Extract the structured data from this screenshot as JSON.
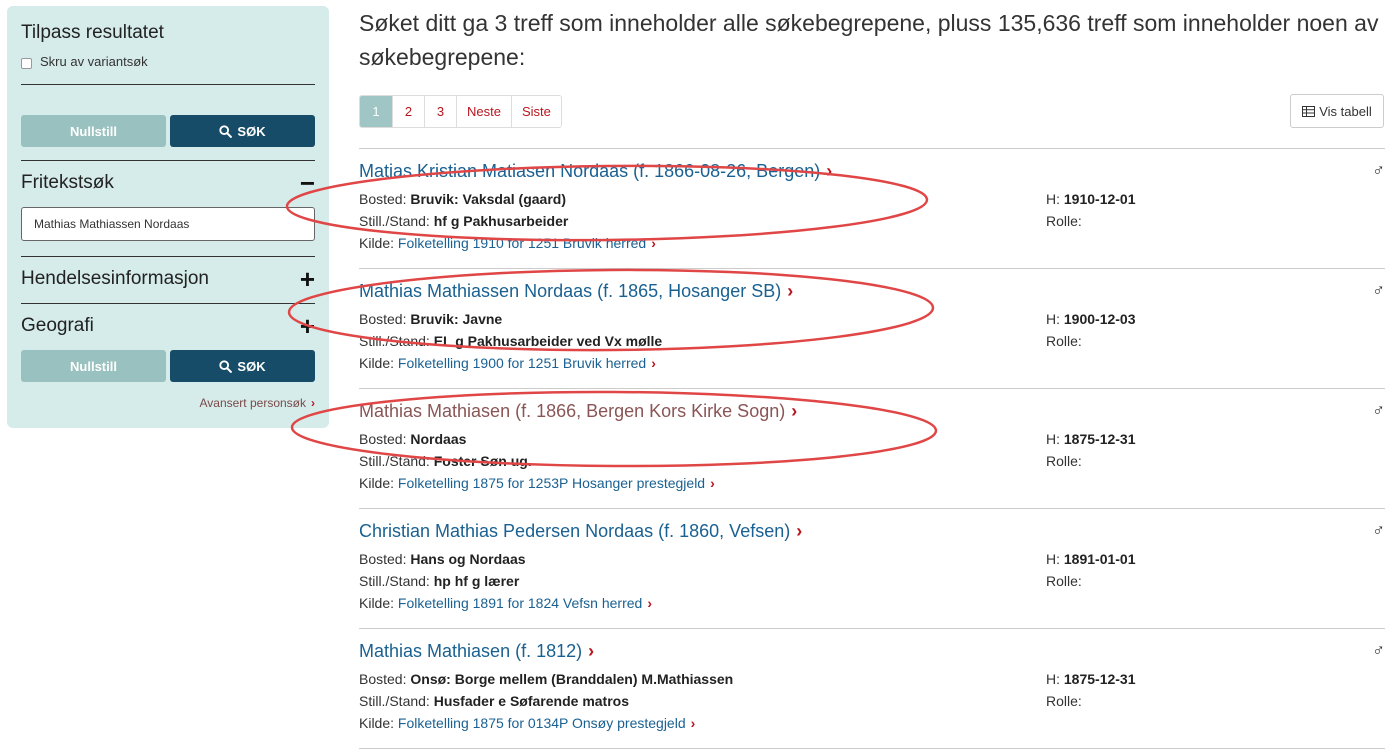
{
  "sidebar": {
    "title": "Tilpass resultatet",
    "variant_checkbox_label": "Skru av variantsøk",
    "reset_label": "Nullstill",
    "search_label": "SØK",
    "freetext_heading": "Fritekstsøk",
    "freetext_toggle": "−",
    "freetext_value": "Mathias Mathiassen Nordaas",
    "event_heading": "Hendelsesinformasjon",
    "event_toggle": "+",
    "geo_heading": "Geografi",
    "geo_toggle": "+",
    "advanced_link": "Avansert personsøk"
  },
  "main": {
    "summary": "Søket ditt ga 3 treff som inneholder alle søkebegrepene, pluss 135,636 treff som inneholder noen av søkebegrepene:",
    "pagination": [
      "1",
      "2",
      "3",
      "Neste",
      "Siste"
    ],
    "table_view_label": "Vis tabell",
    "results": [
      {
        "name": "Matias Kristian Matiasen Nordaas (f. 1866-08-26, Bergen)",
        "bosted_label": "Bosted:",
        "bosted": "Bruvik: Vaksdal (gaard)",
        "stand_label": "Still./Stand:",
        "stand": "hf g Pakhusarbeider",
        "kilde_label": "Kilde:",
        "kilde": "Folketelling 1910 for 1251 Bruvik herred",
        "h_label": "H:",
        "h_date": "1910-12-01",
        "rolle_label": "Rolle:",
        "gender": "♂"
      },
      {
        "name": "Mathias Mathiassen Nordaas (f. 1865, Hosanger SB)",
        "bosted_label": "Bosted:",
        "bosted": "Bruvik: Javne",
        "stand_label": "Still./Stand:",
        "stand": "EL g Pakhusarbeider ved Vx mølle",
        "kilde_label": "Kilde:",
        "kilde": "Folketelling 1900 for 1251 Bruvik herred",
        "h_label": "H:",
        "h_date": "1900-12-03",
        "rolle_label": "Rolle:",
        "gender": "♂"
      },
      {
        "name": "Mathias Mathiasen (f. 1866, Bergen Kors Kirke Sogn)",
        "bosted_label": "Bosted:",
        "bosted": "Nordaas",
        "stand_label": "Still./Stand:",
        "stand": "Foster Søn ug.",
        "kilde_label": "Kilde:",
        "kilde": "Folketelling 1875 for 1253P Hosanger prestegjeld",
        "h_label": "H:",
        "h_date": "1875-12-31",
        "rolle_label": "Rolle:",
        "gender": "♂"
      },
      {
        "name": "Christian Mathias Pedersen Nordaas (f. 1860, Vefsen)",
        "bosted_label": "Bosted:",
        "bosted": "Hans og Nordaas",
        "stand_label": "Still./Stand:",
        "stand": "hp hf g lærer",
        "kilde_label": "Kilde:",
        "kilde": "Folketelling 1891 for 1824 Vefsn herred",
        "h_label": "H:",
        "h_date": "1891-01-01",
        "rolle_label": "Rolle:",
        "gender": "♂"
      },
      {
        "name": "Mathias Mathiasen (f. 1812)",
        "bosted_label": "Bosted:",
        "bosted": "Onsø: Borge mellem (Branddalen) M.Mathiassen",
        "stand_label": "Still./Stand:",
        "stand": "Husfader e Søfarende matros",
        "kilde_label": "Kilde:",
        "kilde": "Folketelling 1875 for 0134P Onsøy prestegjeld",
        "h_label": "H:",
        "h_date": "1875-12-31",
        "rolle_label": "Rolle:",
        "gender": "♂"
      }
    ]
  },
  "colors": {
    "sidebar_bg": "#d6ecea",
    "primary_button": "#164c67",
    "secondary_button": "#99c1bf",
    "link": "#1a6192",
    "chevron": "#b8161f",
    "annotation": "#e04646"
  }
}
